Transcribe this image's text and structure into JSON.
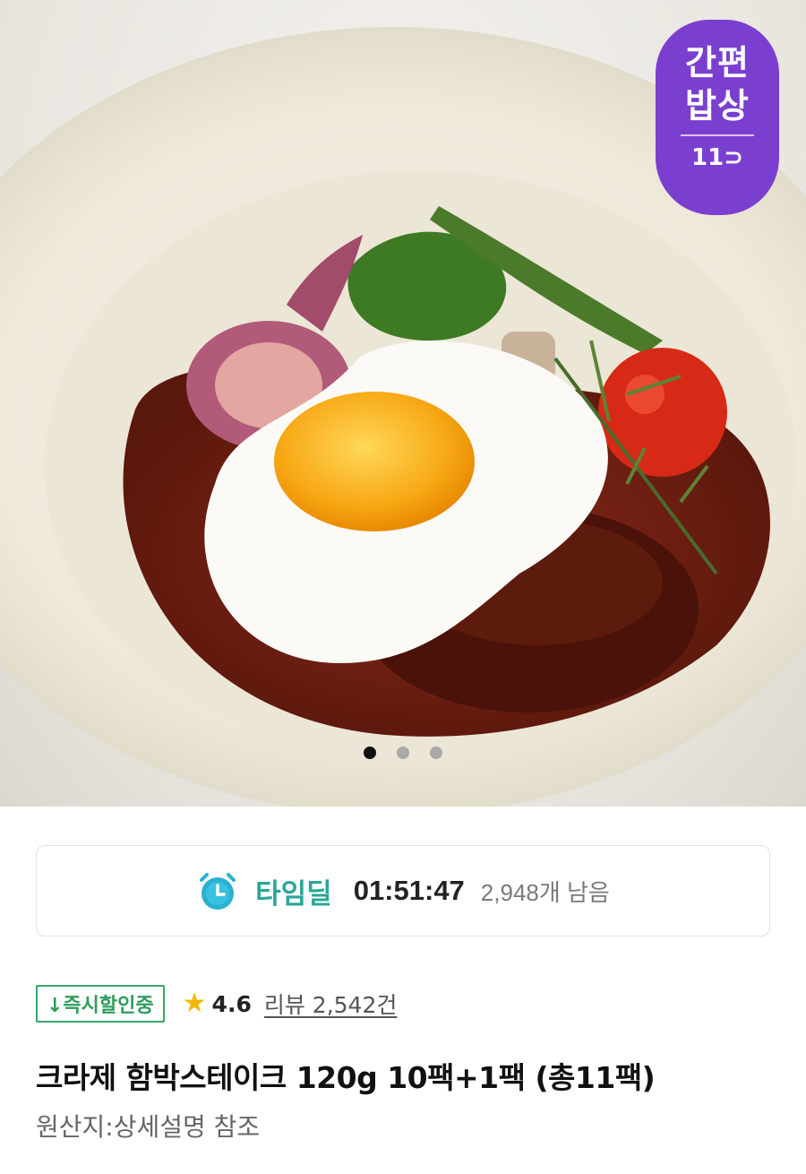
{
  "badge": {
    "line1": "간편",
    "line2": "밥상",
    "logo": "11⊃"
  },
  "carousel": {
    "total": 3,
    "active_index": 0
  },
  "timedeal": {
    "icon": "alarm-clock-icon",
    "label": "타임딜",
    "time_left": "01:51:47",
    "remaining": "2,948개 남음"
  },
  "meta": {
    "instant_discount": "↓즉시할인중",
    "rating": "4.6",
    "reviews": "리뷰 2,542건"
  },
  "product": {
    "title": "크라제 함박스테이크 120g 10팩+1팩 (총11팩)",
    "origin": "원산지:상세설명 참조"
  },
  "colors": {
    "accent_teal": "#2aa69a",
    "badge_purple": "#7a3fcf",
    "star": "#f5b800",
    "instant_green": "#3aa56a"
  }
}
